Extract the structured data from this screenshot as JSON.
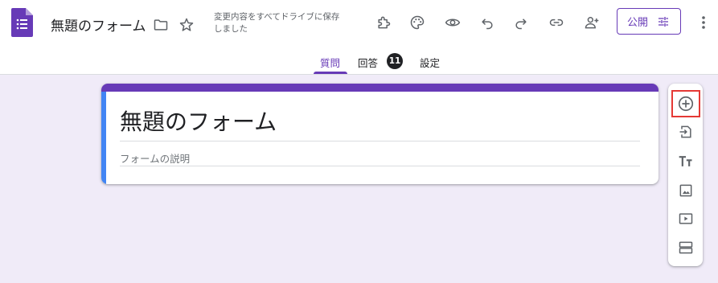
{
  "header": {
    "doc_title": "無題のフォーム",
    "save_status": "変更内容をすべてドライブに保存しました",
    "publish_label": "公開",
    "icons": [
      "forms-logo-icon",
      "folder-icon",
      "star-icon",
      "addon-puzzle-icon",
      "palette-icon",
      "preview-eye-icon",
      "undo-icon",
      "redo-icon",
      "link-icon",
      "add-collaborator-icon",
      "tune-icon",
      "more-vert-icon"
    ]
  },
  "tabs": [
    {
      "label": "質問",
      "active": true
    },
    {
      "label": "回答",
      "count": "11"
    },
    {
      "label": "設定"
    }
  ],
  "form": {
    "title": "無題のフォーム",
    "description_placeholder": "フォームの説明"
  },
  "sidebar": {
    "items": [
      "add-question-icon",
      "import-questions-icon",
      "add-title-text-icon",
      "add-image-icon",
      "add-video-icon",
      "add-section-icon"
    ],
    "highlighted": "add-question-icon"
  },
  "colors": {
    "accent": "#673ab7",
    "background": "#f0ebf8",
    "card_left_bar": "#4285f4",
    "highlight_box": "#e53935"
  }
}
